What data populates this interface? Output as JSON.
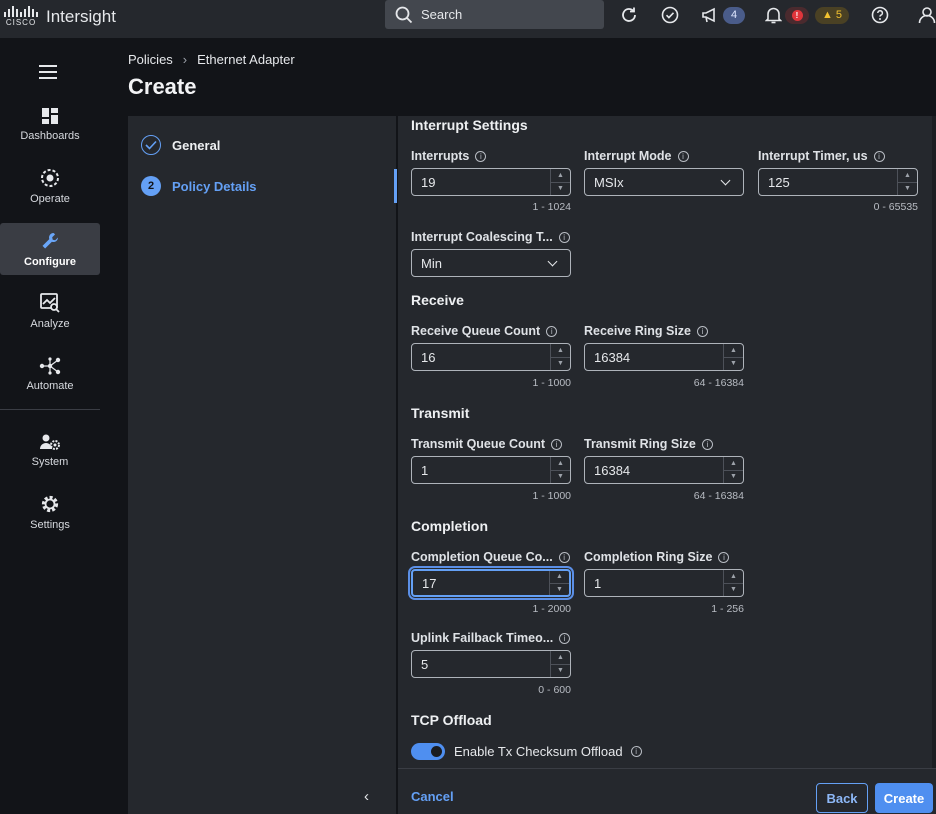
{
  "app": {
    "title": "Intersight",
    "logo_text": "CISCO"
  },
  "search": {
    "label": "Search"
  },
  "topbar": {
    "announcements_count": "4",
    "alarms_critical": "!",
    "alarms_warning": "5"
  },
  "sidebar": {
    "items": [
      {
        "label": "Dashboards",
        "icon": "dashboard-icon"
      },
      {
        "label": "Operate",
        "icon": "operate-icon"
      },
      {
        "label": "Configure",
        "icon": "wrench-icon",
        "active": true
      },
      {
        "label": "Analyze",
        "icon": "analyze-icon"
      },
      {
        "label": "Automate",
        "icon": "automate-icon"
      },
      {
        "label": "System",
        "icon": "system-icon"
      },
      {
        "label": "Settings",
        "icon": "gear-icon"
      }
    ]
  },
  "breadcrumb": {
    "items": [
      "Policies",
      "Ethernet Adapter"
    ]
  },
  "page": {
    "title": "Create"
  },
  "wizard": {
    "steps": [
      {
        "label": "General",
        "number": "1",
        "state": "complete"
      },
      {
        "label": "Policy Details",
        "number": "2",
        "state": "active"
      }
    ]
  },
  "form": {
    "interrupt": {
      "title": "Interrupt Settings",
      "interrupts": {
        "label": "Interrupts",
        "value": "19",
        "range": "1 - 1024"
      },
      "mode": {
        "label": "Interrupt Mode",
        "value": "MSIx"
      },
      "timer": {
        "label": "Interrupt Timer, us",
        "value": "125",
        "range": "0 - 65535"
      },
      "coalescing": {
        "label": "Interrupt Coalescing T...",
        "value": "Min"
      }
    },
    "receive": {
      "title": "Receive",
      "queue": {
        "label": "Receive Queue Count",
        "value": "16",
        "range": "1 - 1000"
      },
      "ring": {
        "label": "Receive Ring Size",
        "value": "16384",
        "range": "64 - 16384"
      }
    },
    "transmit": {
      "title": "Transmit",
      "queue": {
        "label": "Transmit Queue Count",
        "value": "1",
        "range": "1 - 1000"
      },
      "ring": {
        "label": "Transmit Ring Size",
        "value": "16384",
        "range": "64 - 16384"
      }
    },
    "completion": {
      "title": "Completion",
      "queue": {
        "label": "Completion Queue Co...",
        "value": "17",
        "range": "1 - 2000"
      },
      "ring": {
        "label": "Completion Ring Size",
        "value": "1",
        "range": "1 - 256"
      },
      "uplink": {
        "label": "Uplink Failback Timeo...",
        "value": "5",
        "range": "0 - 600"
      }
    },
    "tcp": {
      "title": "TCP Offload",
      "tx_checksum": {
        "label": "Enable Tx Checksum Offload",
        "enabled": true
      }
    }
  },
  "footer": {
    "cancel": "Cancel",
    "back": "Back",
    "create": "Create"
  },
  "colors": {
    "accent": "#4f8ff0",
    "panel": "#25282d",
    "background": "#121418",
    "critical": "#e0353b",
    "warning": "#f2c230"
  }
}
